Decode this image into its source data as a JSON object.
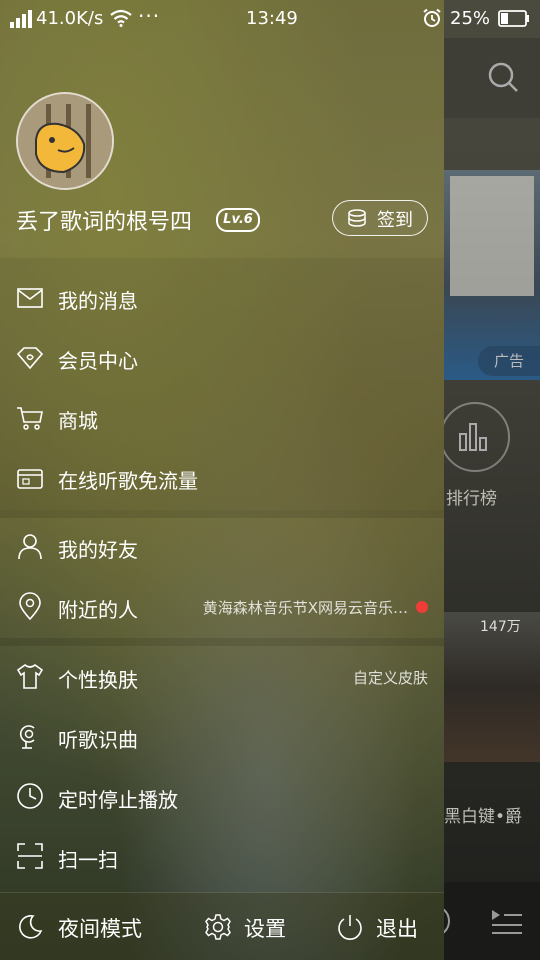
{
  "status_bar": {
    "speed": "41.0K/s",
    "dots": "···",
    "time": "13:49",
    "battery": "25%"
  },
  "profile": {
    "username": "丢了歌词的根号四",
    "level": "Lv.6",
    "signin_label": "签到"
  },
  "menu": {
    "group1": [
      {
        "label": "我的消息",
        "icon": "mail-icon"
      },
      {
        "label": "会员中心",
        "icon": "diamond-icon"
      },
      {
        "label": "商城",
        "icon": "cart-icon"
      },
      {
        "label": "在线听歌免流量",
        "icon": "sim-card-icon"
      }
    ],
    "group2": [
      {
        "label": "我的好友",
        "icon": "person-icon"
      },
      {
        "label": "附近的人",
        "icon": "location-pin-icon",
        "detail": "黄海森林音乐节X网易云音乐…"
      }
    ],
    "group3": [
      {
        "label": "个性换肤",
        "icon": "tshirt-icon",
        "detail": "自定义皮肤"
      },
      {
        "label": "听歌识曲",
        "icon": "microphone-icon"
      },
      {
        "label": "定时停止播放",
        "icon": "clock-icon"
      },
      {
        "label": "扫一扫",
        "icon": "scan-icon"
      }
    ]
  },
  "bottom_bar": {
    "night_mode": "夜间模式",
    "settings": "设置",
    "logout": "退出"
  },
  "background_app": {
    "ad_badge": "广告",
    "rank_label": "排行榜",
    "play_count": "147万",
    "playlist_title": "黑白键•爵"
  }
}
